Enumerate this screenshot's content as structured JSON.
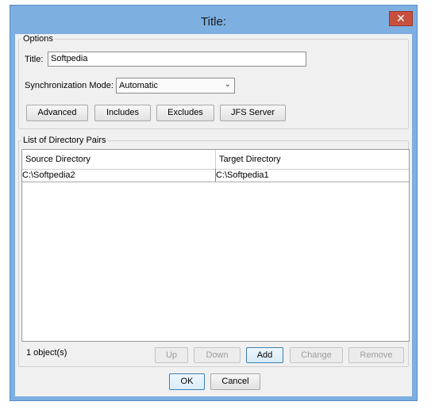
{
  "window": {
    "title": "Title:",
    "close_glyph": "✕"
  },
  "options": {
    "group_label": "Options",
    "title_label": "Title:",
    "title_value": "Softpedia",
    "sync_label": "Synchronization Mode:",
    "sync_value": "Automatic",
    "buttons": {
      "advanced": "Advanced",
      "includes": "Includes",
      "excludes": "Excludes",
      "jfs_server": "JFS Server"
    }
  },
  "pairs": {
    "group_label": "List of Directory Pairs",
    "columns": [
      "Source Directory",
      "Target Directory"
    ],
    "rows": [
      [
        "C:\\Softpedia2",
        "C:\\Softpedia1"
      ]
    ],
    "count": "1 object(s)",
    "buttons": {
      "up": "Up",
      "down": "Down",
      "add": "Add",
      "change": "Change",
      "remove": "Remove"
    }
  },
  "dialog": {
    "ok": "OK",
    "cancel": "Cancel"
  },
  "icons": {
    "close": "close-icon",
    "dropdown": "chevron-down-icon"
  },
  "colors": {
    "frame": "#7dafe1",
    "close_button": "#c7503f",
    "client_background": "#f0f0f0"
  }
}
